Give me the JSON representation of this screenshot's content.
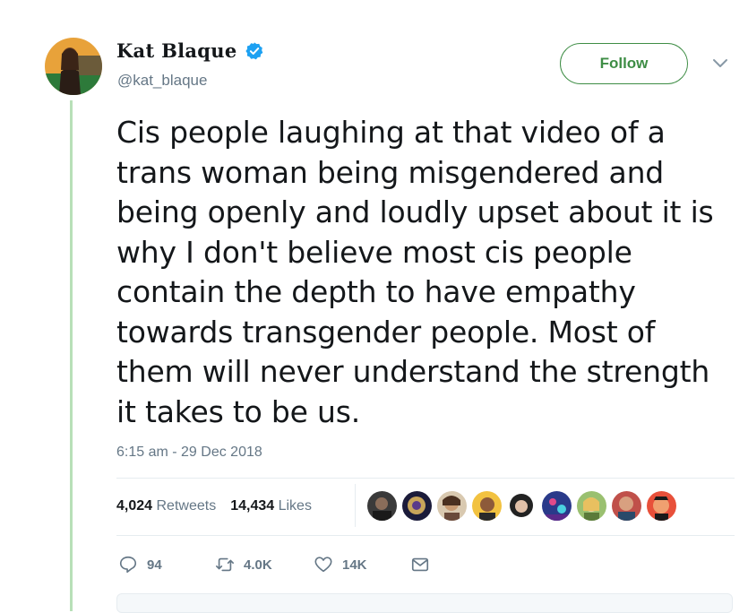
{
  "author": {
    "display_name": "Kat Blaque",
    "handle": "@kat_blaque",
    "verified": true,
    "avatar_icon": "profile-photo-avatar"
  },
  "follow_label": "Follow",
  "tweet": {
    "text": "Cis people laughing at that video of a\ntrans woman being misgendered and\nbeing openly and loudly upset about it is\nwhy I don't believe most cis people\ncontain the depth to have empathy\ntowards transgender people. Most of\nthem will never understand the strength\nit takes to be us.",
    "timestamp": "6:15 am - 29 Dec 2018"
  },
  "stats": {
    "retweets_count": "4,024",
    "retweets_label": "Retweets",
    "likes_count": "14,434",
    "likes_label": "Likes"
  },
  "actions": {
    "reply_count": "94",
    "retweet_count": "4.0K",
    "like_count": "14K"
  },
  "colors": {
    "accent_green": "#3e8d45",
    "thread_line": "#b8e0b8",
    "verified_blue": "#1da1f2",
    "muted_text": "#657786"
  }
}
